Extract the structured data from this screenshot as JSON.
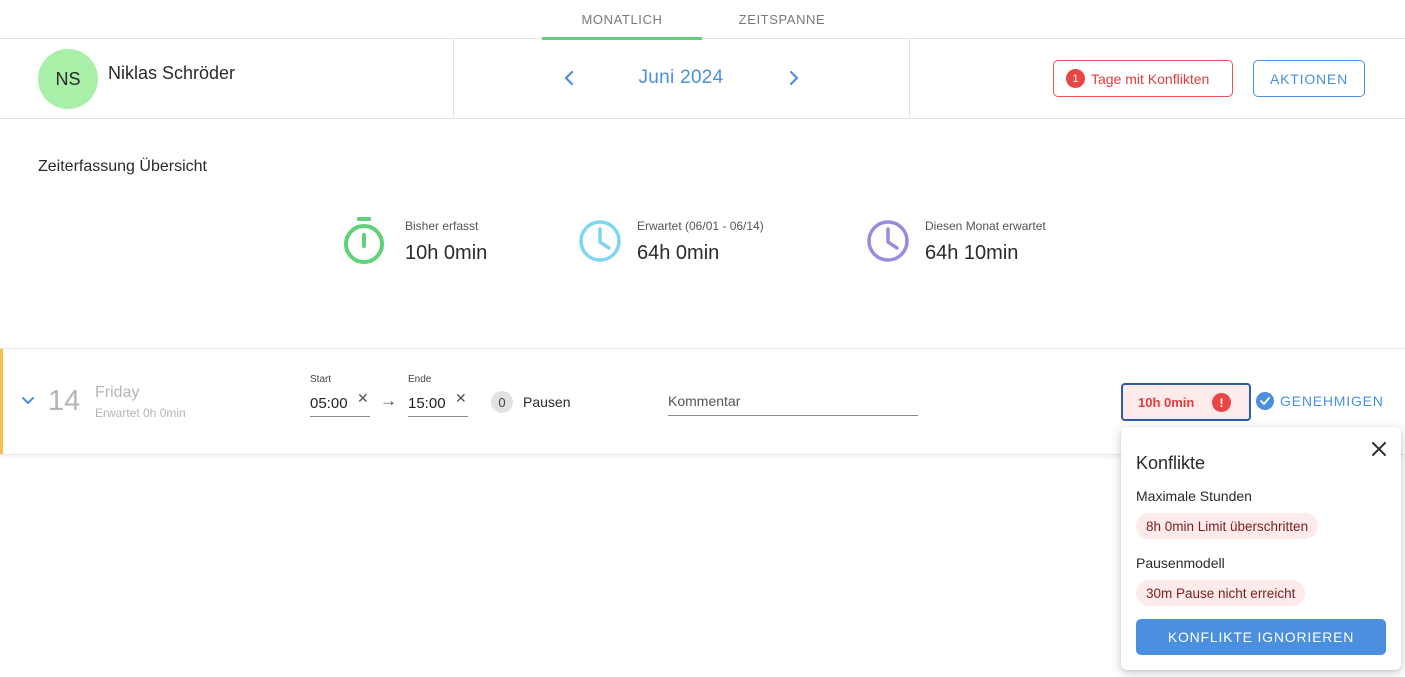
{
  "tabs": [
    {
      "label": "MONATLICH",
      "active": true
    },
    {
      "label": "ZEITSPANNE",
      "active": false
    }
  ],
  "user": {
    "initials": "NS",
    "name": "Niklas Schröder"
  },
  "period": {
    "label": "Juni 2024"
  },
  "header": {
    "conflicts_count": "1",
    "conflicts_label": "Tage mit Konflikten",
    "actions_label": "AKTIONEN"
  },
  "overview": {
    "title": "Zeiterfassung Übersicht",
    "stats": [
      {
        "label": "Bisher erfasst",
        "value": "10h 0min",
        "icon": "stopwatch-icon",
        "color": "#5fd17a"
      },
      {
        "label": "Erwartet (06/01 - 06/14)",
        "value": "64h 0min",
        "icon": "clock-icon",
        "color": "#7fd6f0"
      },
      {
        "label": "Diesen Monat erwartet",
        "value": "64h 10min",
        "icon": "clock-icon",
        "color": "#9a8ae0"
      }
    ]
  },
  "day": {
    "number": "14",
    "weekday": "Friday",
    "expected": "Erwartet 0h 0min",
    "start_label": "Start",
    "start_value": "05:00",
    "end_label": "Ende",
    "end_value": "15:00",
    "arrow": "→",
    "clear_glyph": "✕",
    "pause_count": "0",
    "pause_label": "Pausen",
    "comment_placeholder": "Kommentar",
    "total": "10h 0min",
    "approve_label": "GENEHMIGEN"
  },
  "conflicts_popover": {
    "title": "Konflikte",
    "sections": [
      {
        "heading": "Maximale Stunden",
        "chip": "8h 0min Limit überschritten"
      },
      {
        "heading": "Pausenmodell",
        "chip": "30m Pause nicht erreicht"
      }
    ],
    "ignore_label": "KONFLIKTE IGNORIEREN"
  },
  "colors": {
    "accent": "#4a8fe0",
    "tab_indicator": "#5fd17a",
    "error": "#e84545",
    "row_marker": "#f5c04a"
  }
}
